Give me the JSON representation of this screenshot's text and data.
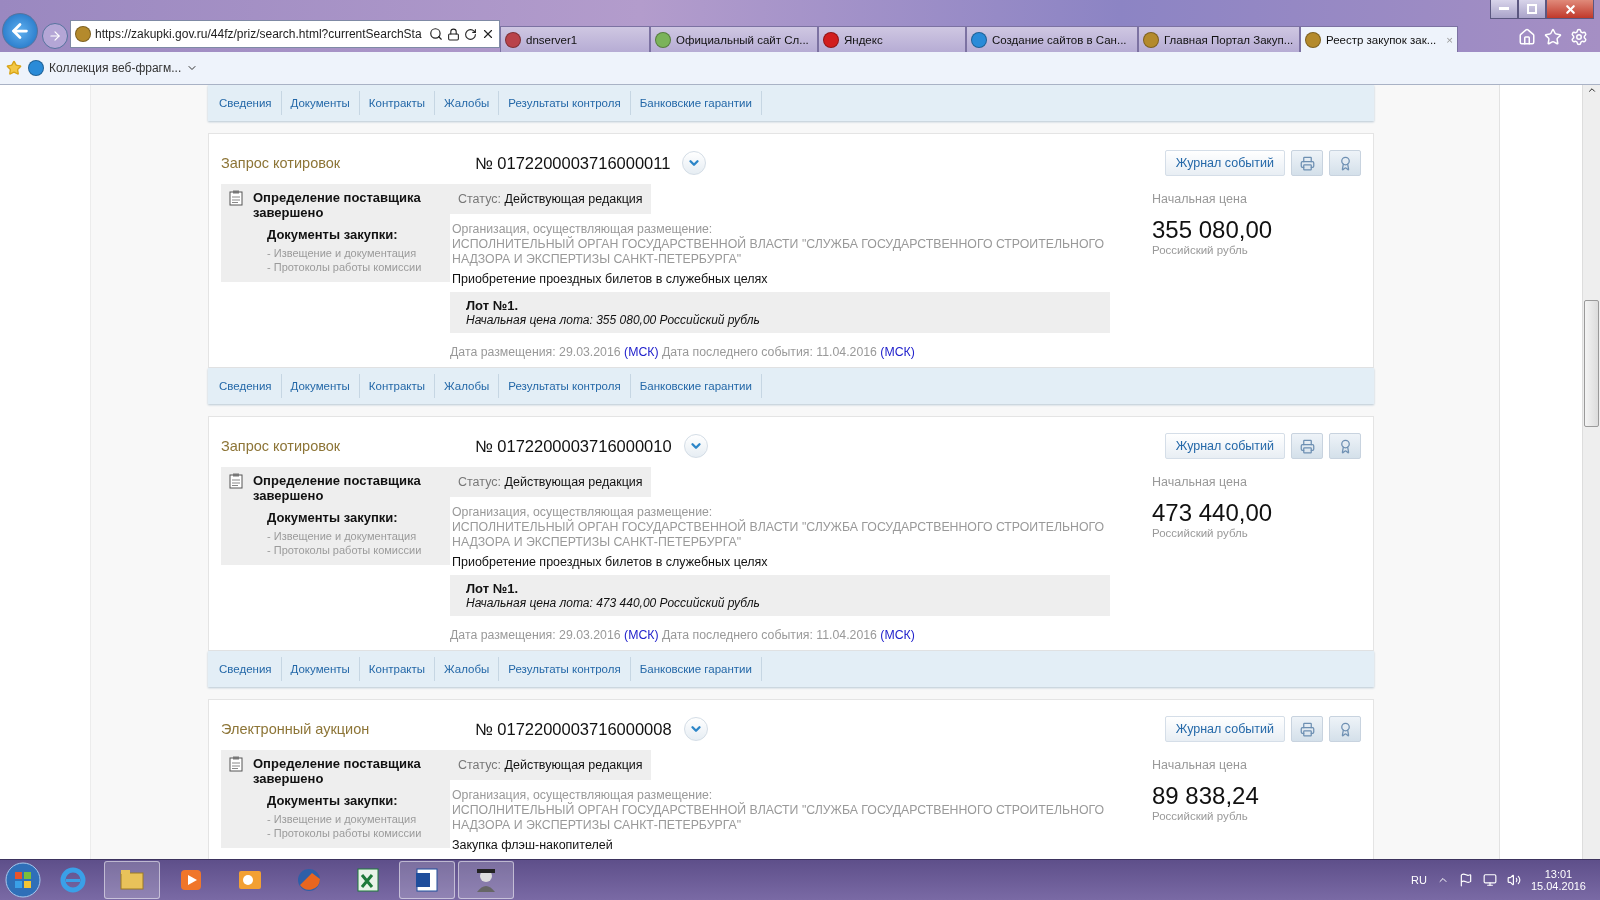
{
  "browser": {
    "address": "https://zakupki.gov.ru/44fz/priz/search.html?currentSearchSta",
    "tabs": [
      {
        "title": "dnserver1",
        "selected": false,
        "kind": "shield"
      },
      {
        "title": "Официальный сайт Сл...",
        "selected": false,
        "kind": "emblem"
      },
      {
        "title": "Яндекс",
        "selected": false,
        "kind": "yandex"
      },
      {
        "title": "Создание сайтов в Сан...",
        "selected": false,
        "kind": "ie"
      },
      {
        "title": "Главная Портал Закуп...",
        "selected": false,
        "kind": "eagle"
      },
      {
        "title": "Реестр закупок зак...",
        "selected": true,
        "kind": "eagle",
        "close": "×"
      }
    ],
    "favorites": [
      {
        "title": "Коллекция веб-фрагм..."
      }
    ]
  },
  "top_nav": [
    "Сведения",
    "Документы",
    "Контракты",
    "Жалобы",
    "Результаты контроля",
    "Банковские гарантии"
  ],
  "cards": [
    {
      "type": "Запрос котировок",
      "number": "№ 0172200003716000011",
      "journal": "Журнал событий",
      "stage": "Определение поставщика завершено",
      "docs_title": "Документы закупки:",
      "docs": [
        "- Извещение и документация",
        "- Протоколы работы комиссии"
      ],
      "status_label": "Статус:",
      "status": "Действующая редакция",
      "org_label": "Организация, осуществляющая размещение:",
      "org": "ИСПОЛНИТЕЛЬНЫЙ ОРГАН ГОСУДАРСТВЕННОЙ ВЛАСТИ \"СЛУЖБА ГОСУДАРСТВЕННОГО СТРОИТЕЛЬНОГО НАДЗОРА И ЭКСПЕРТИЗЫ САНКТ-ПЕТЕРБУРГА\"",
      "subject": "Приобретение проездных билетов в служебных целях",
      "lot": {
        "title": "Лот №1.",
        "price": "Начальная цена лота: 355 080,00 Российский рубль"
      },
      "posted": "Дата размещения: 29.03.2016",
      "posted_tz": "(МСК)",
      "last_event": "Дата последнего события: 11.04.2016",
      "last_event_tz": "(МСК)",
      "price_label": "Начальная цена",
      "price": "355 080,00",
      "currency": "Российский рубль",
      "nav": [
        "Сведения",
        "Документы",
        "Контракты",
        "Жалобы",
        "Результаты контроля",
        "Банковские гарантии"
      ]
    },
    {
      "type": "Запрос котировок",
      "number": "№ 0172200003716000010",
      "journal": "Журнал событий",
      "stage": "Определение поставщика завершено",
      "docs_title": "Документы закупки:",
      "docs": [
        "- Извещение и документация",
        "- Протоколы работы комиссии"
      ],
      "status_label": "Статус:",
      "status": "Действующая редакция",
      "org_label": "Организация, осуществляющая размещение:",
      "org": "ИСПОЛНИТЕЛЬНЫЙ ОРГАН ГОСУДАРСТВЕННОЙ ВЛАСТИ \"СЛУЖБА ГОСУДАРСТВЕННОГО СТРОИТЕЛЬНОГО НАДЗОРА И ЭКСПЕРТИЗЫ САНКТ-ПЕТЕРБУРГА\"",
      "subject": "Приобретение проездных билетов в служебных целях",
      "lot": {
        "title": "Лот №1.",
        "price": "Начальная цена лота: 473 440,00 Российский рубль"
      },
      "posted": "Дата размещения: 29.03.2016",
      "posted_tz": "(МСК)",
      "last_event": "Дата последнего события: 11.04.2016",
      "last_event_tz": "(МСК)",
      "price_label": "Начальная цена",
      "price": "473 440,00",
      "currency": "Российский рубль",
      "nav": [
        "Сведения",
        "Документы",
        "Контракты",
        "Жалобы",
        "Результаты контроля",
        "Банковские гарантии"
      ]
    },
    {
      "type": "Электронный аукцион",
      "number": "№ 0172200003716000008",
      "journal": "Журнал событий",
      "stage": "Определение поставщика завершено",
      "docs_title": "Документы закупки:",
      "docs": [
        "- Извещение и документация",
        "- Протоколы работы комиссии"
      ],
      "status_label": "Статус:",
      "status": "Действующая редакция",
      "org_label": "Организация, осуществляющая размещение:",
      "org": "ИСПОЛНИТЕЛЬНЫЙ ОРГАН ГОСУДАРСТВЕННОЙ ВЛАСТИ \"СЛУЖБА ГОСУДАРСТВЕННОГО СТРОИТЕЛЬНОГО НАДЗОРА И ЭКСПЕРТИЗЫ САНКТ-ПЕТЕРБУРГА\"",
      "subject": "Закупка флэш-накопителей",
      "price_label": "Начальная цена",
      "price": "89 838,24",
      "currency": "Российский рубль"
    }
  ],
  "taskbar": {
    "apps": [
      {
        "kind": "ie",
        "running": false
      },
      {
        "kind": "folder",
        "running": true
      },
      {
        "kind": "media",
        "running": false
      },
      {
        "kind": "outlook",
        "running": false
      },
      {
        "kind": "firefox",
        "running": false
      },
      {
        "kind": "excel",
        "running": false
      },
      {
        "kind": "word",
        "running": true
      },
      {
        "kind": "figure",
        "running": true
      }
    ],
    "language": "RU",
    "time": "13:01",
    "date": "15.04.2016"
  }
}
